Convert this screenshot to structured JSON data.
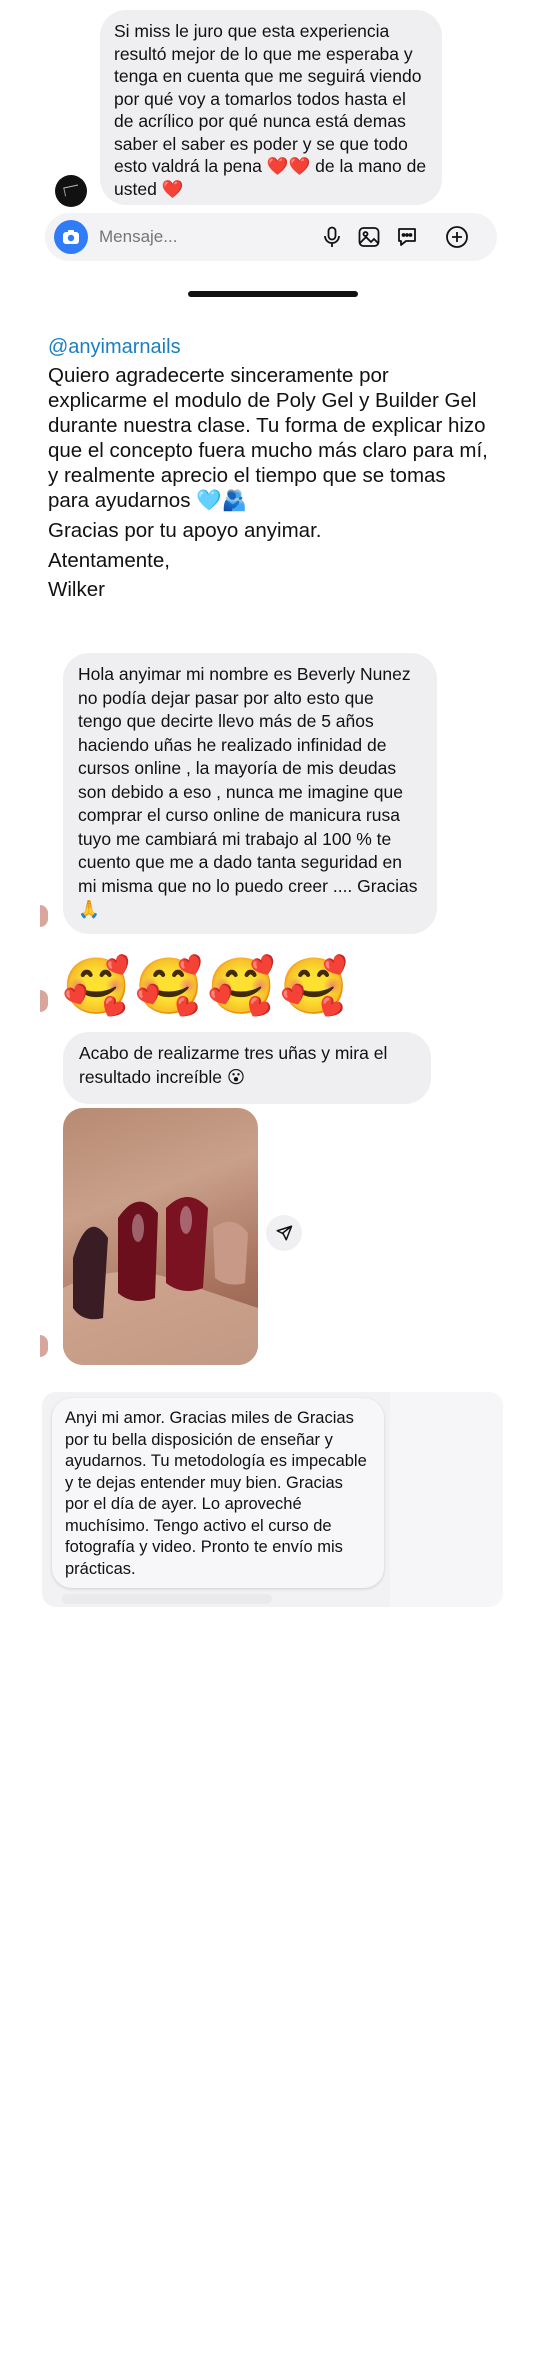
{
  "messages": {
    "m1": "Si miss le juro que esta experiencia resultó mejor de lo que me esperaba y tenga en cuenta que me seguirá viendo por qué voy a tomarlos todos hasta el de acrílico por qué nunca está demas saber el saber es poder y se que todo esto valdrá la pena ❤️❤️ de la mano de usted ❤️",
    "m2": "Hola anyimar mi nombre es Beverly Nunez no podía dejar pasar por alto esto que tengo que decirte llevo más de 5 años haciendo uñas he realizado infinidad de cursos online , la mayoría de mis deudas son debido a eso , nunca me imagine que comprar el curso online de manicura rusa tuyo me cambiará mi trabajo al 100 % te cuento que me a dado tanta seguridad en mi misma que no lo puedo creer .... Gracias 🙏",
    "m3": "🥰🥰🥰🥰",
    "m4": "Acabo de realizarme tres uñas y mira el resultado increíble 😮",
    "m5": "Anyi mi amor. Gracias miles de Gracias por tu bella disposición de enseñar y ayudarnos. Tu metodología es impecable y te dejas entender muy bien. Gracias por el día de ayer. Lo aproveché muchísimo. Tengo activo el curso de fotografía y video. Pronto te envío mis prácticas."
  },
  "composer": {
    "placeholder": "Mensaje..."
  },
  "letter": {
    "handle": "@anyimarnails",
    "paragraph": "Quiero agradecerte sinceramente por explicarme  el modulo de Poly Gel y Builder Gel durante nuestra clase. Tu forma de explicar hizo que el concepto fuera mucho más claro para mí, y realmente aprecio el tiempo que se tomas para ayudarnos 🩵🫂",
    "thanks": "Gracias por tu apoyo anyimar.",
    "closing": "Atentamente,",
    "signature": " Wilker"
  },
  "icons": {
    "composer": [
      "camera-icon",
      "microphone-icon",
      "gallery-icon",
      "sticker-icon",
      "plus-icon"
    ],
    "photo": "share-icon"
  },
  "colors": {
    "accent": "#2f7cf6",
    "handle": "#1a7fc1",
    "bubble": "#efeff1"
  }
}
